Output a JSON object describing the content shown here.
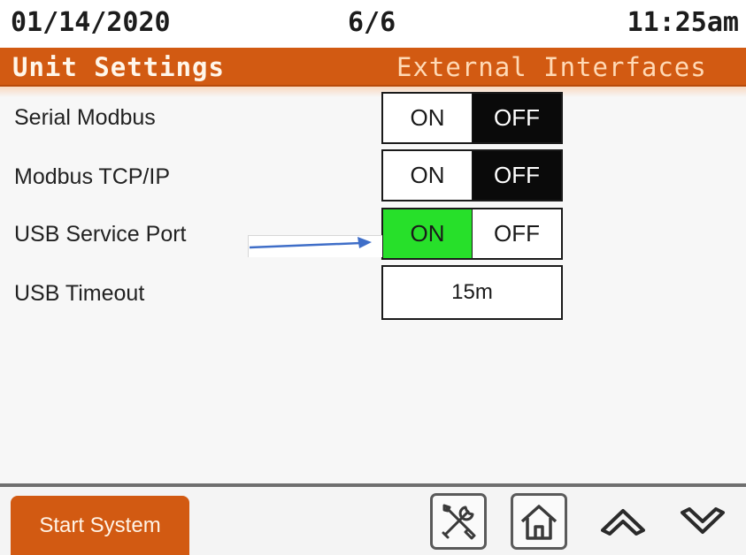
{
  "status": {
    "date": "01/14/2020",
    "page": "6/6",
    "time": "11:25am"
  },
  "title": {
    "left": "Unit Settings",
    "right": "External Interfaces"
  },
  "settings": [
    {
      "label": "Serial Modbus",
      "on_label": "ON",
      "off_label": "OFF",
      "selected": "OFF"
    },
    {
      "label": "Modbus TCP/IP",
      "on_label": "ON",
      "off_label": "OFF",
      "selected": "OFF"
    },
    {
      "label": "USB Service Port",
      "on_label": "ON",
      "off_label": "OFF",
      "selected": "ON"
    },
    {
      "label": "USB Timeout",
      "value": "15m"
    }
  ],
  "footer": {
    "start_label": "Start System",
    "icons": [
      "tools-icon",
      "home-icon",
      "chevron-up-icon",
      "chevron-down-icon"
    ]
  },
  "colors": {
    "accent": "#d25a12",
    "on_selected": "#27e02a",
    "off_selected": "#0a0a0a",
    "annotation_arrow": "#3f6ec8"
  }
}
